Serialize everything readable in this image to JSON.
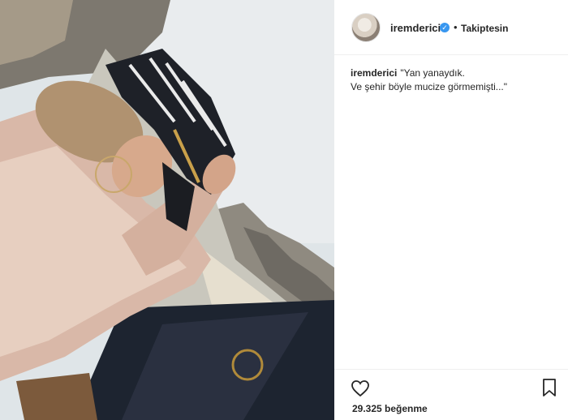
{
  "post": {
    "username": "iremderici",
    "verified_icon": "verified-badge-icon",
    "separator": "•",
    "follow_status": "Takiptesin",
    "caption_user": "iremderici",
    "caption_line1": "\"Yan yanaydık.",
    "caption_line2": "Ve şehir böyle mucize görmemişti...\"",
    "likes_text": "29.325 beğenme"
  },
  "icons": {
    "heart": "heart-icon",
    "bookmark": "bookmark-icon"
  },
  "colors": {
    "text": "#262626",
    "verified": "#3897f0",
    "divider": "#efefef"
  }
}
